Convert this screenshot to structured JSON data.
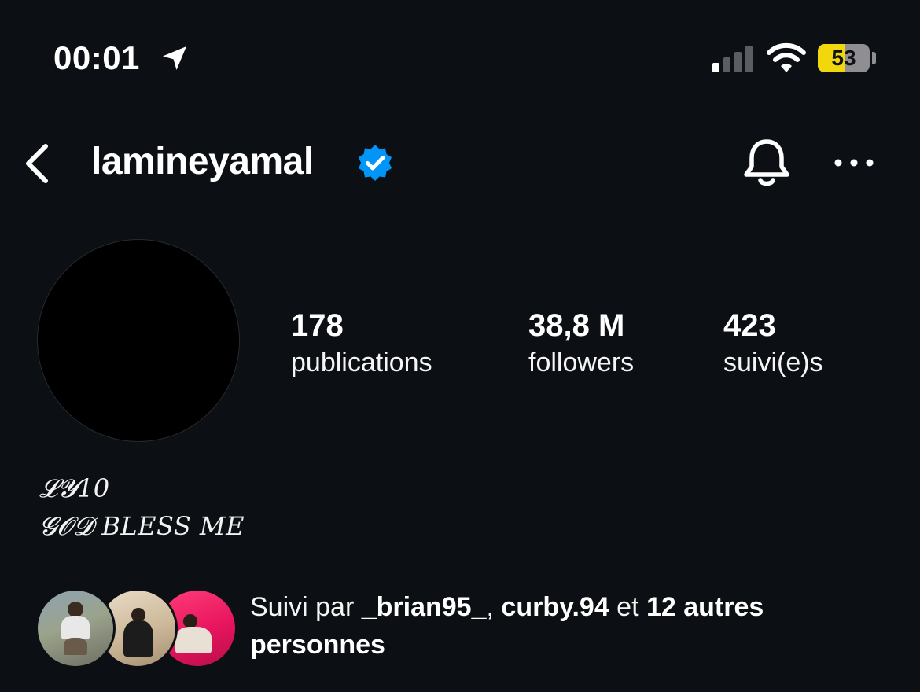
{
  "status_bar": {
    "time": "00:01",
    "battery_level": "53",
    "battery_fraction": 0.53,
    "icons": [
      "location-arrow-icon",
      "signal-icon",
      "wifi-icon",
      "battery-icon"
    ]
  },
  "header": {
    "username": "lamineyamal",
    "verified": true,
    "icons": [
      "back-chevron-icon",
      "verified-badge-icon",
      "bell-icon",
      "more-dots-icon"
    ]
  },
  "stats": {
    "posts": {
      "value": "178",
      "label": "publications"
    },
    "followers": {
      "value": "38,8 M",
      "label": "followers"
    },
    "following": {
      "value": "423",
      "label": "suivi(e)s"
    }
  },
  "bio": {
    "line1": "𝓛𝓨10",
    "line2": "𝓖𝓞𝓓 BLESS ME"
  },
  "followed_by": {
    "prefix": "Suivi par ",
    "user1": "_brian95_",
    "sep": ", ",
    "user2": "curby.94",
    "middle": " et ",
    "others": "12 autres personnes"
  },
  "colors": {
    "background": "#0c1014",
    "text": "#ffffff",
    "verified_blue": "#0095f6",
    "battery_yellow": "#f2d70c"
  }
}
